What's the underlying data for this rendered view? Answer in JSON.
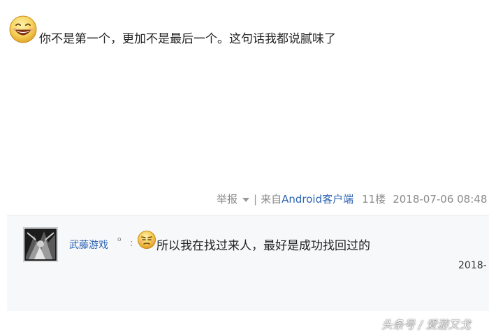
{
  "post": {
    "emoji": "grinning-emoji",
    "text": "你不是第一个，更加不是最后一个。这句话我都说腻味了"
  },
  "meta": {
    "report_label": "举报",
    "separator": "|",
    "from_label": "来自",
    "client_label": "Android客户端",
    "floor_label": "11楼",
    "datetime": "2018-07-06 08:48"
  },
  "reply": {
    "username": "武藤游戏",
    "badge": "o",
    "colon": ":",
    "emoji": "annoyed-emoji",
    "text": "所以我在找过来人，最好是成功找回过的",
    "date": "2018-"
  },
  "watermark": {
    "text": "头条号 / 爱游又戈"
  },
  "colors": {
    "link": "#2d64b3",
    "meta": "#8a8a8a",
    "reply_bg": "#f7f8fa"
  }
}
